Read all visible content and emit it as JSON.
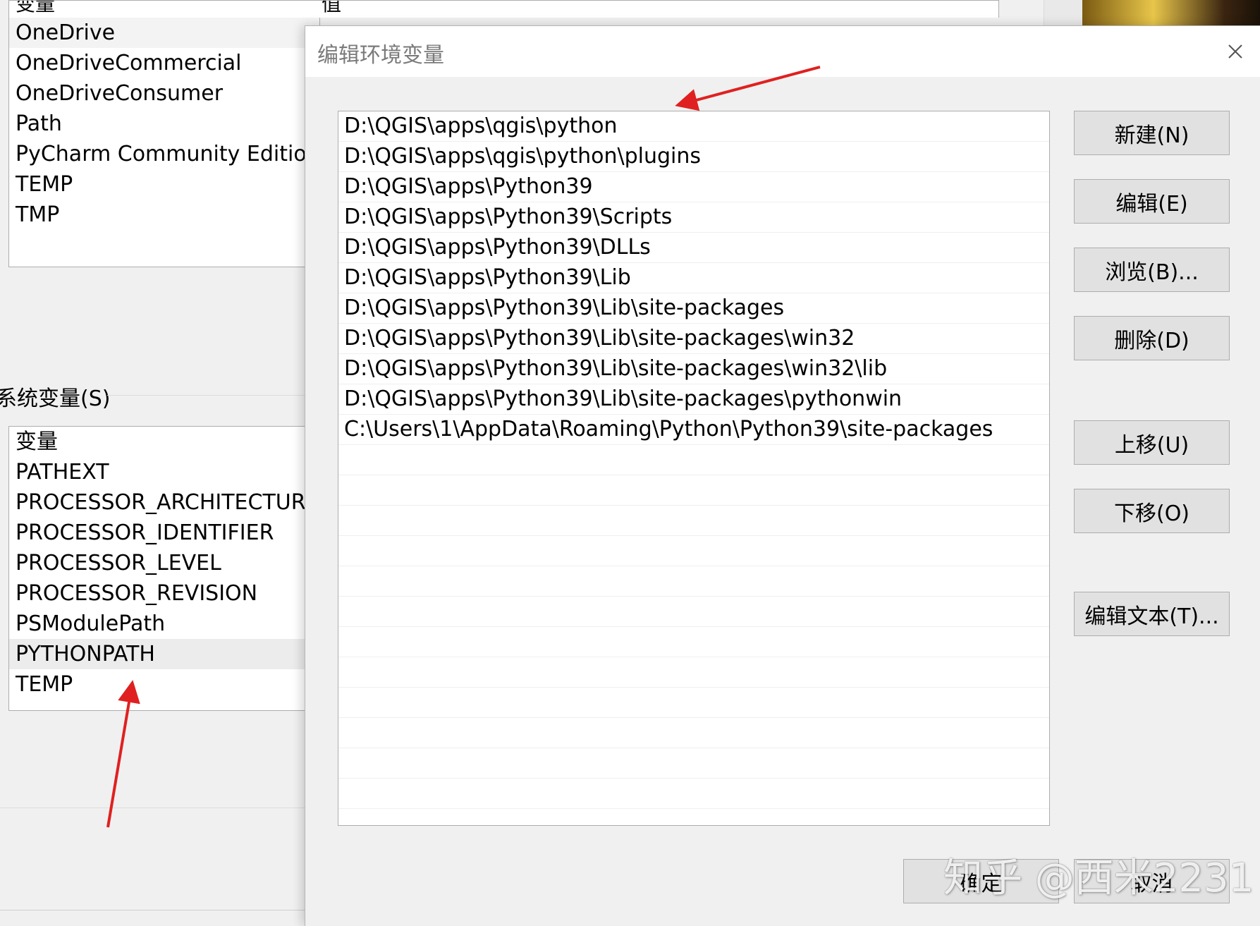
{
  "background": {
    "user_vars": {
      "col_variable": "变量",
      "col_value": "值",
      "items": [
        "OneDrive",
        "OneDriveCommercial",
        "OneDriveConsumer",
        "Path",
        "PyCharm Community Edition",
        "TEMP",
        "TMP"
      ],
      "selected_index": 0
    },
    "system_vars": {
      "group_label": "系统变量(S)",
      "items": [
        "变量",
        "PATHEXT",
        "PROCESSOR_ARCHITECTURE",
        "PROCESSOR_IDENTIFIER",
        "PROCESSOR_LEVEL",
        "PROCESSOR_REVISION",
        "PSModulePath",
        "PYTHONPATH",
        "TEMP"
      ],
      "selected_index": 7
    }
  },
  "dialog": {
    "title": "编辑环境变量",
    "paths": [
      "D:\\QGIS\\apps\\qgis\\python",
      "D:\\QGIS\\apps\\qgis\\python\\plugins",
      "D:\\QGIS\\apps\\Python39",
      "D:\\QGIS\\apps\\Python39\\Scripts",
      "D:\\QGIS\\apps\\Python39\\DLLs",
      "D:\\QGIS\\apps\\Python39\\Lib",
      "D:\\QGIS\\apps\\Python39\\Lib\\site-packages",
      "D:\\QGIS\\apps\\Python39\\Lib\\site-packages\\win32",
      "D:\\QGIS\\apps\\Python39\\Lib\\site-packages\\win32\\lib",
      "D:\\QGIS\\apps\\Python39\\Lib\\site-packages\\pythonwin",
      "C:\\Users\\1\\AppData\\Roaming\\Python\\Python39\\site-packages",
      "",
      "",
      "",
      "",
      "",
      "",
      "",
      "",
      "",
      "",
      "",
      "",
      ""
    ],
    "buttons": {
      "new": "新建(N)",
      "edit": "编辑(E)",
      "browse": "浏览(B)...",
      "delete": "删除(D)",
      "move_up": "上移(U)",
      "move_down": "下移(O)",
      "edit_text": "编辑文本(T)...",
      "ok": "确定",
      "cancel": "取消"
    }
  },
  "watermark": "知乎 @西米2231",
  "annotation_color": "#e02020"
}
